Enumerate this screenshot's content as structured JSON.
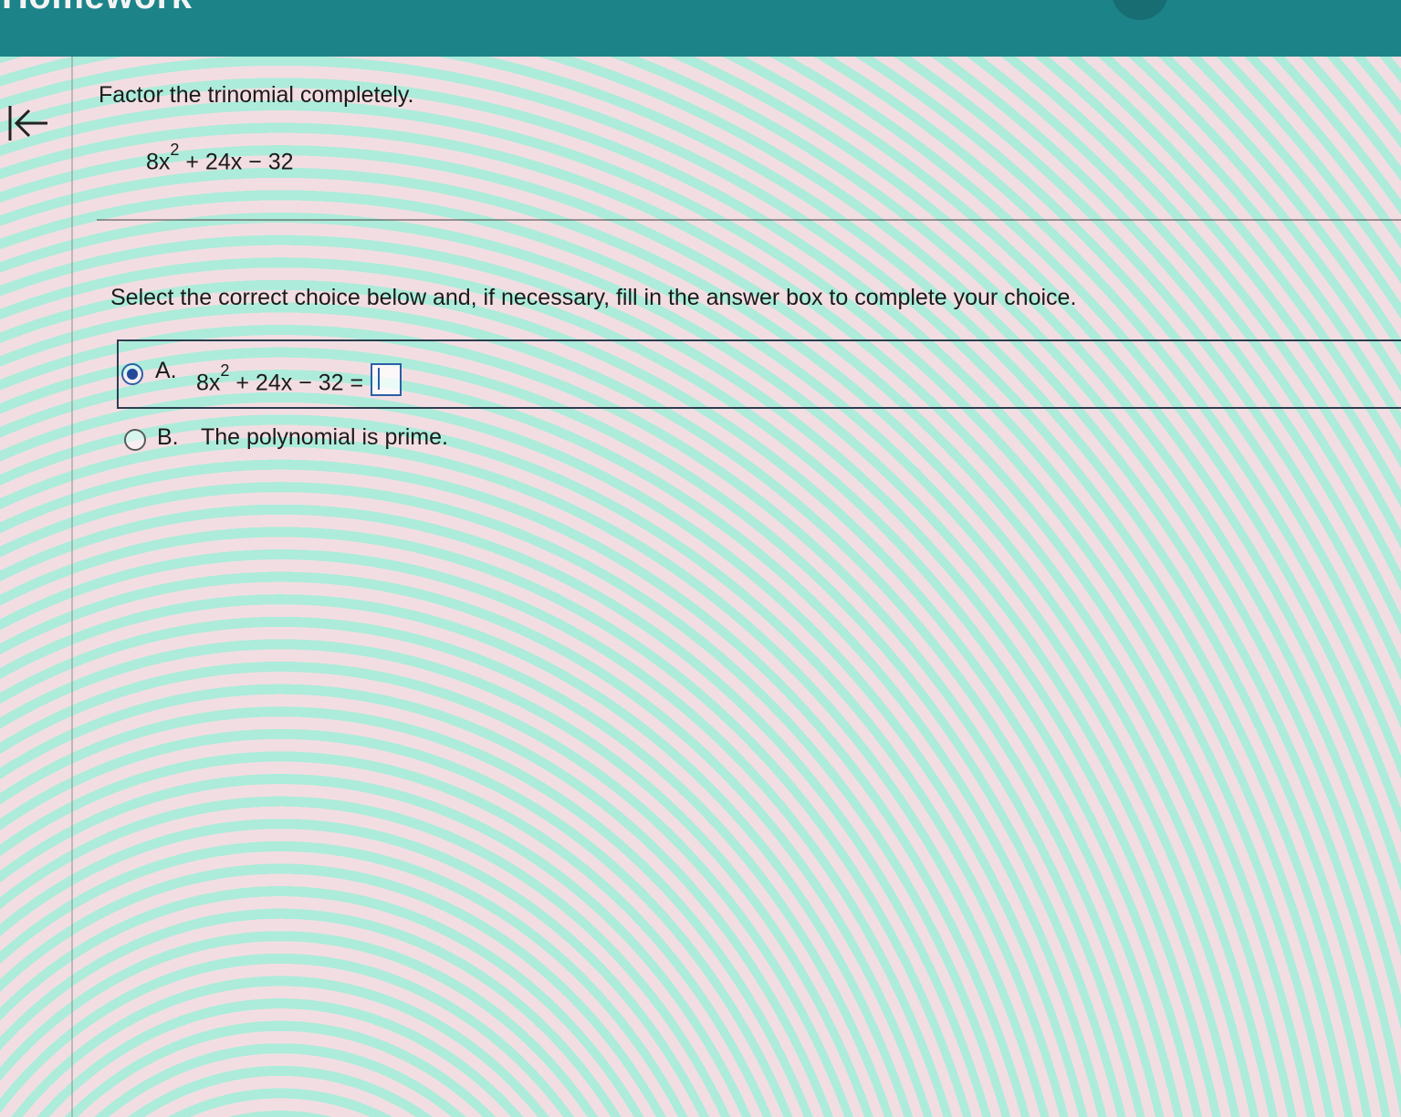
{
  "header": {
    "title": "Homework"
  },
  "question": {
    "prompt": "Factor the trinomial completely.",
    "expression": {
      "coef": "8x",
      "exponent": "2",
      "rest": " + 24x − 32"
    },
    "instruction": "Select the correct choice below and, if necessary, fill in the answer box to complete your choice."
  },
  "choices": [
    {
      "letter": "A.",
      "expression": {
        "coef": "8x",
        "exponent": "2",
        "rest": " + 24x − 32 ="
      },
      "answer_value": "",
      "selected": true
    },
    {
      "letter": "B.",
      "text": "The polynomial is prime.",
      "selected": false
    }
  ],
  "colors": {
    "header_bg": "#1c8389",
    "selection_accent": "#2b5fa7"
  },
  "icons": {
    "back": "back-to-start-arrow-icon"
  }
}
